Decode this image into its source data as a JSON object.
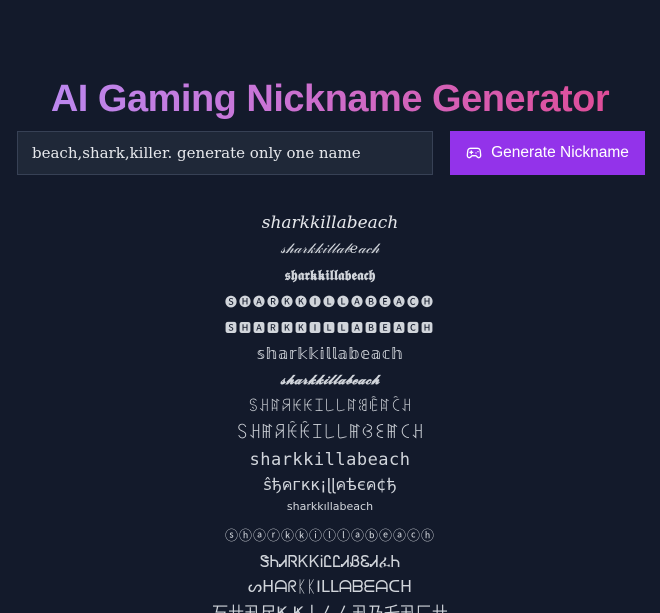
{
  "header": {
    "title": "AI Gaming Nickname Generator"
  },
  "form": {
    "input_value": "beach,shark,killer. generate only one name",
    "button_label": "Generate Nickname",
    "button_icon": "gamepad-icon"
  },
  "colors": {
    "background": "#131a2b",
    "button": "#9333ea",
    "title_gradient_start": "#b98cf4",
    "title_gradient_end": "#e2478f",
    "text": "#d1d5db"
  },
  "results": [
    "sharkkillabeach",
    "𝓈𝒽𝒶𝓇𝓀𝓀𝒾𝓁𝓁𝒶𝒷𝑒𝒶𝒸𝒽",
    "𝖘𝖍𝖆𝖗𝖐𝖐𝖎𝖑𝖑𝖆𝖇𝖊𝖆𝖈𝖍",
    "🅢🅗🅐🅡🅚🅚🅘🅛🅛🅐🅑🅔🅐🅒🅗",
    "🆂🅷🅰🆁🅺🅺🅸🅻🅻🅰🅱🅴🅰🅲🅷",
    "𝕤𝕙𝕒𝕣𝕜𝕜𝕚𝕝𝕝𝕒𝕓𝕖𝕒𝕔𝕙",
    "𝓼𝓱𝓪𝓻𝓴𝓴𝓲𝓵𝓵𝓪𝓫𝓮𝓪𝓬𝓱",
    "ꌗꃅꍏꋪꀘꀘꀤ꒒꒒ꍏꌃꍟꍏꉓꃅ",
    "ꇙꃅꂵꋪꀗꀗꀤ꒒꒒ꂵꃳꏂꂵꉔꃅ",
    "𝚜𝚑𝚊𝚛𝚔𝚔𝚒𝚕𝚕𝚊𝚋𝚎𝚊𝚌𝚑",
    "ŝђคгкк¡ɭɭคѣєค¢ђ",
    "sharkkıllabeach",
    "ⓢⓗⓐⓡⓚⓚⓘⓛⓛⓐⓑⓔⓐⓒⓗ",
    "ᏕᏂᏗᏒᏦᏦᎥᏝᏝᏗᏰᏋᏗፈᏂ",
    "ᔕᕼᗩᖇᛕᛕIᒪᒪᗩᗷᗴᗩᑕᕼ",
    "丂卄卂尺Ҝ Ҝ丨ㄥㄥ卂乃乇卂匚卄"
  ]
}
